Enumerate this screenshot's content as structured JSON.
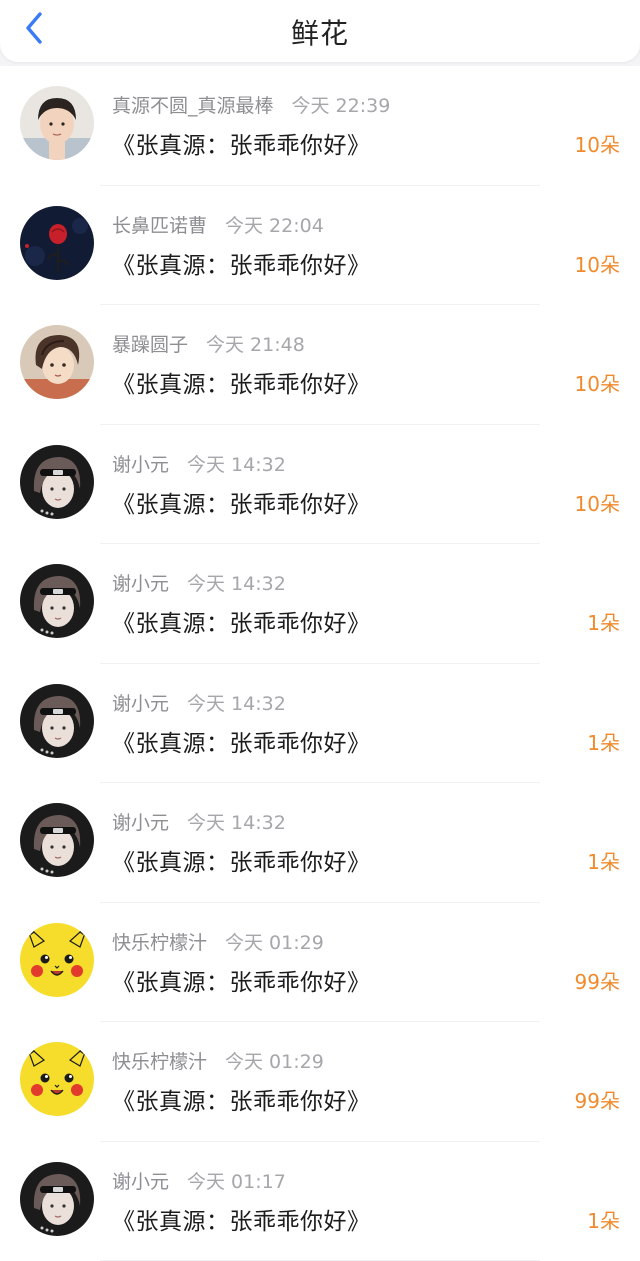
{
  "header": {
    "title": "鲜花",
    "back_icon": "chevron-left-icon",
    "accent_color": "#3a7bf6"
  },
  "colors": {
    "amount": "#f08a2c",
    "name": "#8e8e93",
    "text": "#1c1c1e"
  },
  "items": [
    {
      "avatar": "boy-photo",
      "name": "真源不圆_真源最棒",
      "time": "今天 22:39",
      "text": "《张真源：张乖乖你好》",
      "amount": "10朵"
    },
    {
      "avatar": "rose-dark",
      "name": "长鼻匹诺曹",
      "time": "今天 22:04",
      "text": "《张真源：张乖乖你好》",
      "amount": "10朵"
    },
    {
      "avatar": "anime-boy",
      "name": "暴躁圆子",
      "time": "今天 21:48",
      "text": "《张真源：张乖乖你好》",
      "amount": "10朵"
    },
    {
      "avatar": "headband-boy",
      "name": "谢小元",
      "time": "今天 14:32",
      "text": "《张真源：张乖乖你好》",
      "amount": "10朵"
    },
    {
      "avatar": "headband-boy",
      "name": "谢小元",
      "time": "今天 14:32",
      "text": "《张真源：张乖乖你好》",
      "amount": "1朵"
    },
    {
      "avatar": "headband-boy",
      "name": "谢小元",
      "time": "今天 14:32",
      "text": "《张真源：张乖乖你好》",
      "amount": "1朵"
    },
    {
      "avatar": "headband-boy",
      "name": "谢小元",
      "time": "今天 14:32",
      "text": "《张真源：张乖乖你好》",
      "amount": "1朵"
    },
    {
      "avatar": "pikachu",
      "name": "快乐柠檬汁",
      "time": "今天 01:29",
      "text": "《张真源：张乖乖你好》",
      "amount": "99朵"
    },
    {
      "avatar": "pikachu",
      "name": "快乐柠檬汁",
      "time": "今天 01:29",
      "text": "《张真源：张乖乖你好》",
      "amount": "99朵"
    },
    {
      "avatar": "headband-boy",
      "name": "谢小元",
      "time": "今天 01:17",
      "text": "《张真源：张乖乖你好》",
      "amount": "1朵"
    }
  ]
}
